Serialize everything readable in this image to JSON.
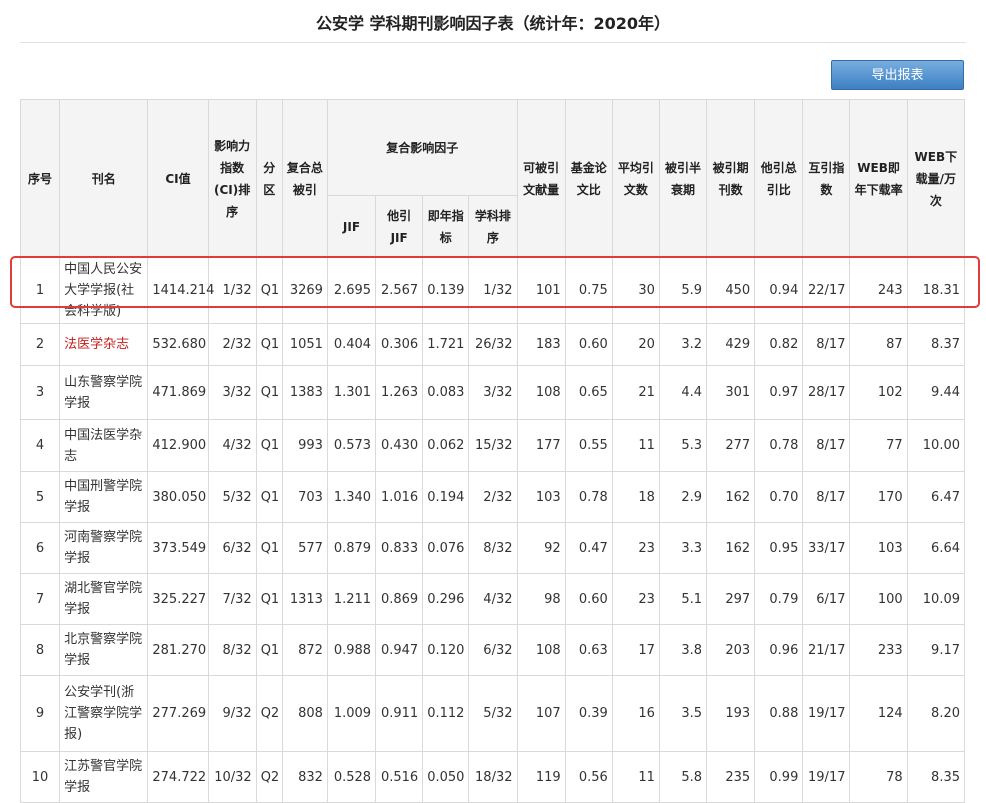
{
  "title": "公安学 学科期刊影响因子表（统计年：2020年）",
  "export_label": "导出报表",
  "colors": {
    "highlight": "#c41c1c",
    "highlight_border": "#e23b3b",
    "button": "#4a8cd0"
  },
  "headers": {
    "no": "序号",
    "name": "刊名",
    "ci": "CI值",
    "ci_rank": "影响力指数(CI)排序",
    "zone": "分区",
    "total_cited": "复合总被引",
    "group": "复合影响因子",
    "jif": "JIF",
    "other_jif": "他引JIF",
    "immediacy": "即年指标",
    "subject_rank": "学科排序",
    "citable": "可被引文献量",
    "fund_ratio": "基金论文比",
    "avg_refs": "平均引文数",
    "half_life": "被引半衰期",
    "cited_journals": "被引期刊数",
    "other_ratio": "他引总引比",
    "mutual": "互引指数",
    "web_rate": "WEB即年下载率",
    "web_downloads": "WEB下载量/万次"
  },
  "rows": [
    {
      "no": "1",
      "name": "中国人民公安大学学报(社会科学版)",
      "ci": "1414.214",
      "ci_rank": "1/32",
      "zone": "Q1",
      "total_cited": "3269",
      "jif": "2.695",
      "other_jif": "2.567",
      "immediacy": "0.139",
      "subject_rank": "1/32",
      "citable": "101",
      "fund_ratio": "0.75",
      "avg_refs": "30",
      "half_life": "5.9",
      "cited_journals": "450",
      "other_ratio": "0.94",
      "mutual": "22/17",
      "web_rate": "243",
      "web_downloads": "18.31"
    },
    {
      "no": "2",
      "name": "法医学杂志",
      "ci": "532.680",
      "ci_rank": "2/32",
      "zone": "Q1",
      "total_cited": "1051",
      "jif": "0.404",
      "other_jif": "0.306",
      "immediacy": "1.721",
      "subject_rank": "26/32",
      "citable": "183",
      "fund_ratio": "0.60",
      "avg_refs": "20",
      "half_life": "3.2",
      "cited_journals": "429",
      "other_ratio": "0.82",
      "mutual": "8/17",
      "web_rate": "87",
      "web_downloads": "8.37"
    },
    {
      "no": "3",
      "name": "山东警察学院学报",
      "ci": "471.869",
      "ci_rank": "3/32",
      "zone": "Q1",
      "total_cited": "1383",
      "jif": "1.301",
      "other_jif": "1.263",
      "immediacy": "0.083",
      "subject_rank": "3/32",
      "citable": "108",
      "fund_ratio": "0.65",
      "avg_refs": "21",
      "half_life": "4.4",
      "cited_journals": "301",
      "other_ratio": "0.97",
      "mutual": "28/17",
      "web_rate": "102",
      "web_downloads": "9.44"
    },
    {
      "no": "4",
      "name": "中国法医学杂志",
      "ci": "412.900",
      "ci_rank": "4/32",
      "zone": "Q1",
      "total_cited": "993",
      "jif": "0.573",
      "other_jif": "0.430",
      "immediacy": "0.062",
      "subject_rank": "15/32",
      "citable": "177",
      "fund_ratio": "0.55",
      "avg_refs": "11",
      "half_life": "5.3",
      "cited_journals": "277",
      "other_ratio": "0.78",
      "mutual": "8/17",
      "web_rate": "77",
      "web_downloads": "10.00"
    },
    {
      "no": "5",
      "name": "中国刑警学院学报",
      "ci": "380.050",
      "ci_rank": "5/32",
      "zone": "Q1",
      "total_cited": "703",
      "jif": "1.340",
      "other_jif": "1.016",
      "immediacy": "0.194",
      "subject_rank": "2/32",
      "citable": "103",
      "fund_ratio": "0.78",
      "avg_refs": "18",
      "half_life": "2.9",
      "cited_journals": "162",
      "other_ratio": "0.70",
      "mutual": "8/17",
      "web_rate": "170",
      "web_downloads": "6.47"
    },
    {
      "no": "6",
      "name": "河南警察学院学报",
      "ci": "373.549",
      "ci_rank": "6/32",
      "zone": "Q1",
      "total_cited": "577",
      "jif": "0.879",
      "other_jif": "0.833",
      "immediacy": "0.076",
      "subject_rank": "8/32",
      "citable": "92",
      "fund_ratio": "0.47",
      "avg_refs": "23",
      "half_life": "3.3",
      "cited_journals": "162",
      "other_ratio": "0.95",
      "mutual": "33/17",
      "web_rate": "103",
      "web_downloads": "6.64"
    },
    {
      "no": "7",
      "name": "湖北警官学院学报",
      "ci": "325.227",
      "ci_rank": "7/32",
      "zone": "Q1",
      "total_cited": "1313",
      "jif": "1.211",
      "other_jif": "0.869",
      "immediacy": "0.296",
      "subject_rank": "4/32",
      "citable": "98",
      "fund_ratio": "0.60",
      "avg_refs": "23",
      "half_life": "5.1",
      "cited_journals": "297",
      "other_ratio": "0.79",
      "mutual": "6/17",
      "web_rate": "100",
      "web_downloads": "10.09"
    },
    {
      "no": "8",
      "name": "北京警察学院学报",
      "ci": "281.270",
      "ci_rank": "8/32",
      "zone": "Q1",
      "total_cited": "872",
      "jif": "0.988",
      "other_jif": "0.947",
      "immediacy": "0.120",
      "subject_rank": "6/32",
      "citable": "108",
      "fund_ratio": "0.63",
      "avg_refs": "17",
      "half_life": "3.8",
      "cited_journals": "203",
      "other_ratio": "0.96",
      "mutual": "21/17",
      "web_rate": "233",
      "web_downloads": "9.17"
    },
    {
      "no": "9",
      "name": "公安学刊(浙江警察学院学报)",
      "ci": "277.269",
      "ci_rank": "9/32",
      "zone": "Q2",
      "total_cited": "808",
      "jif": "1.009",
      "other_jif": "0.911",
      "immediacy": "0.112",
      "subject_rank": "5/32",
      "citable": "107",
      "fund_ratio": "0.39",
      "avg_refs": "16",
      "half_life": "3.5",
      "cited_journals": "193",
      "other_ratio": "0.88",
      "mutual": "19/17",
      "web_rate": "124",
      "web_downloads": "8.20"
    },
    {
      "no": "10",
      "name": "江苏警官学院学报",
      "ci": "274.722",
      "ci_rank": "10/32",
      "zone": "Q2",
      "total_cited": "832",
      "jif": "0.528",
      "other_jif": "0.516",
      "immediacy": "0.050",
      "subject_rank": "18/32",
      "citable": "119",
      "fund_ratio": "0.56",
      "avg_refs": "11",
      "half_life": "5.8",
      "cited_journals": "235",
      "other_ratio": "0.99",
      "mutual": "19/17",
      "web_rate": "78",
      "web_downloads": "8.35"
    }
  ]
}
